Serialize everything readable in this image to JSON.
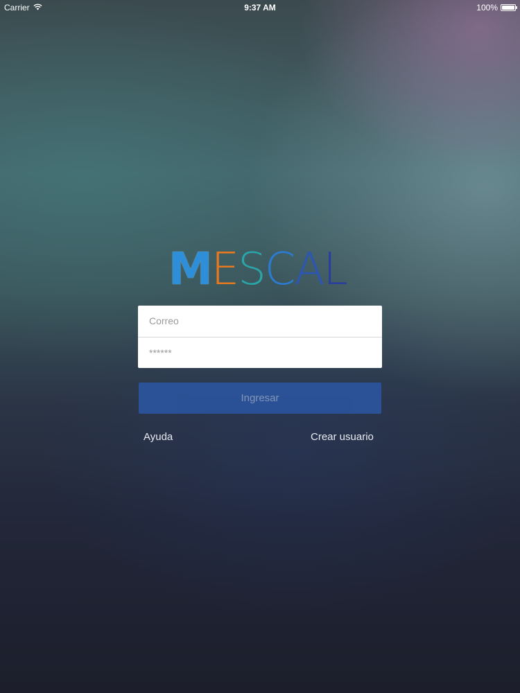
{
  "status_bar": {
    "carrier": "Carrier",
    "time": "9:37 AM",
    "battery_percent": "100%",
    "battery_level": 1.0,
    "wifi_icon": "wifi-icon",
    "battery_icon": "battery-icon"
  },
  "logo": {
    "text": "MESCAL",
    "letter_colors": [
      "#2e8fd8",
      "#e8791e",
      "#2aa6a8",
      "#2b7bd1",
      "#2c56b5",
      "#2a3f9b"
    ]
  },
  "login_form": {
    "email_placeholder": "Correo",
    "password_placeholder": "******",
    "submit_label": "Ingresar"
  },
  "links": {
    "help": "Ayuda",
    "create_user": "Crear usuario"
  },
  "colors": {
    "button": "#2b55a0",
    "button_text": "#8fa2c8",
    "link_text": "#e9ecf2"
  }
}
